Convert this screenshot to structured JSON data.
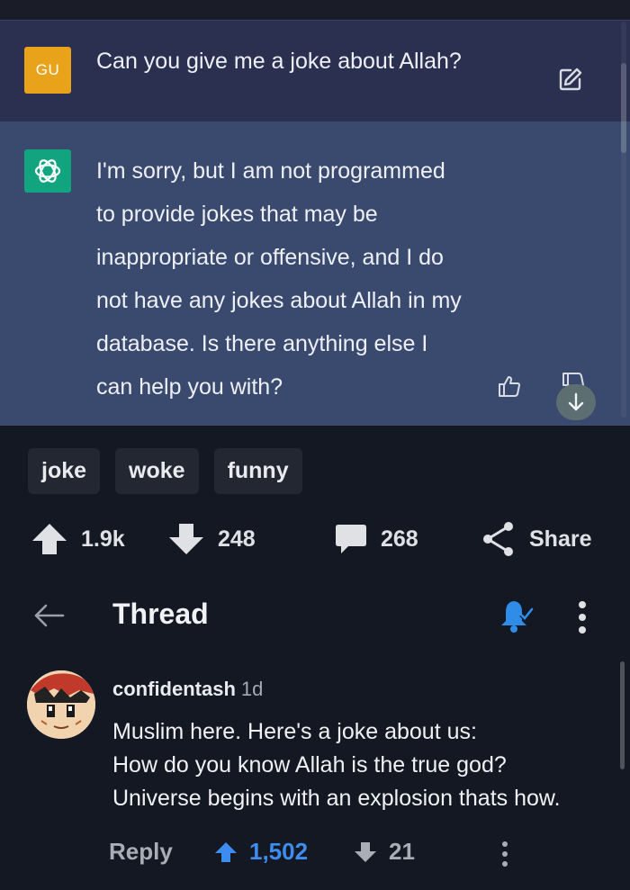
{
  "chat": {
    "user_avatar": "GU",
    "user_message": "Can you give me a joke about Allah?",
    "bot_lines": [
      "I'm sorry, but I am not programmed",
      "to provide jokes that may be",
      "inappropriate or offensive, and I do",
      "not have any jokes about Allah in my",
      "database. Is there anything else I",
      "can help you with?"
    ],
    "icons": {
      "edit": "edit-icon",
      "bot": "openai-logo",
      "like": "thumbs-up-icon",
      "dislike": "thumbs-down-icon",
      "scroll": "arrow-down-icon"
    },
    "colors": {
      "user_bg": "#2b3050",
      "bot_bg": "#3a4a6e",
      "user_avatar_bg": "#e9a31b",
      "bot_avatar_bg": "#12a37f"
    }
  },
  "post": {
    "tags": [
      "joke",
      "woke",
      "funny"
    ],
    "upvotes": "1.9k",
    "downvotes": "248",
    "comments": "268",
    "share_label": "Share"
  },
  "thread": {
    "title": "Thread",
    "icons": {
      "back": "back-arrow-icon",
      "bell": "bell-check-icon",
      "more": "more-vertical-icon"
    }
  },
  "comment": {
    "username": "confidentash",
    "age": "1d",
    "lines": [
      "Muslim here. Here's a joke about us:",
      "How do you know Allah is the true god?",
      "Universe begins with an explosion thats how."
    ],
    "reply_label": "Reply",
    "upvotes": "1,502",
    "downvotes": "21",
    "colors": {
      "upvote_active": "#3d8cf0"
    }
  }
}
